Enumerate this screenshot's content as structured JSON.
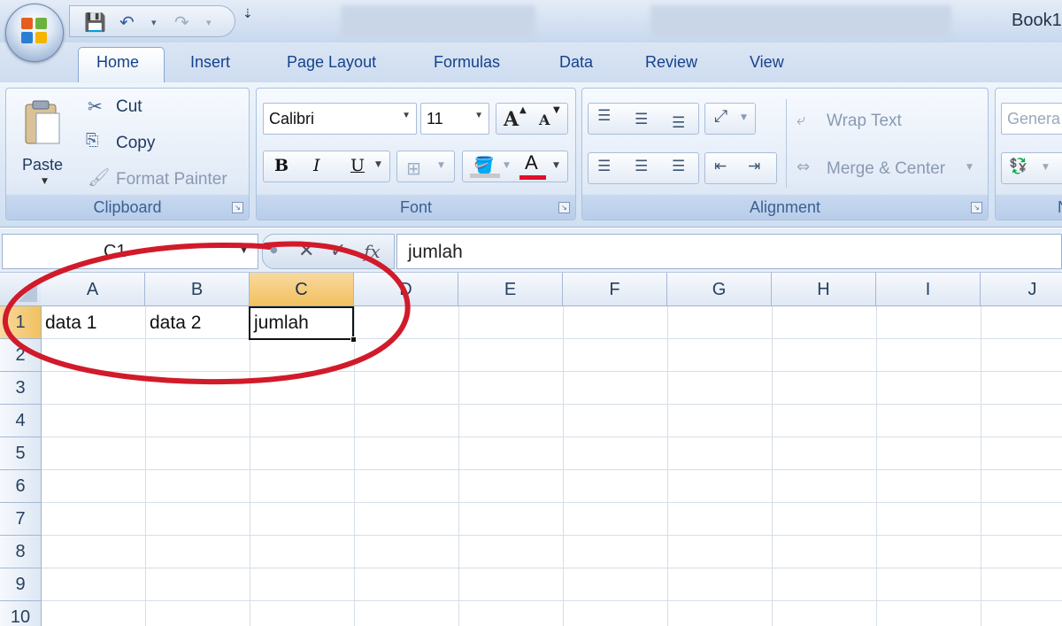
{
  "window": {
    "title": "Book1"
  },
  "tabs": [
    "Home",
    "Insert",
    "Page Layout",
    "Formulas",
    "Data",
    "Review",
    "View"
  ],
  "ribbon": {
    "clipboard": {
      "label": "Clipboard",
      "paste": "Paste",
      "cut": "Cut",
      "copy": "Copy",
      "format_painter": "Format Painter"
    },
    "font": {
      "label": "Font",
      "name": "Calibri",
      "size": "11",
      "bold": "B",
      "italic": "I",
      "underline": "U",
      "grow": "A",
      "shrink": "A",
      "font_color": "A"
    },
    "alignment": {
      "label": "Alignment",
      "wrap_text": "Wrap Text",
      "merge_center": "Merge & Center"
    },
    "number": {
      "format": "Genera",
      "label": "N"
    }
  },
  "formula_bar": {
    "name_box": "C1",
    "fx": "fx",
    "content": "jumlah"
  },
  "grid": {
    "columns": [
      "A",
      "B",
      "C",
      "D",
      "E",
      "F",
      "G",
      "H",
      "I",
      "J"
    ],
    "rows": [
      "1",
      "2",
      "3",
      "4",
      "5",
      "6",
      "7",
      "8",
      "9",
      "10"
    ],
    "active_cell": "C1",
    "cells": {
      "A1": "data 1",
      "B1": "data 2",
      "C1": "jumlah"
    }
  },
  "colors": {
    "accent": "#15428b",
    "active_header": "#f5c970",
    "annotation": "#d11a2a"
  }
}
